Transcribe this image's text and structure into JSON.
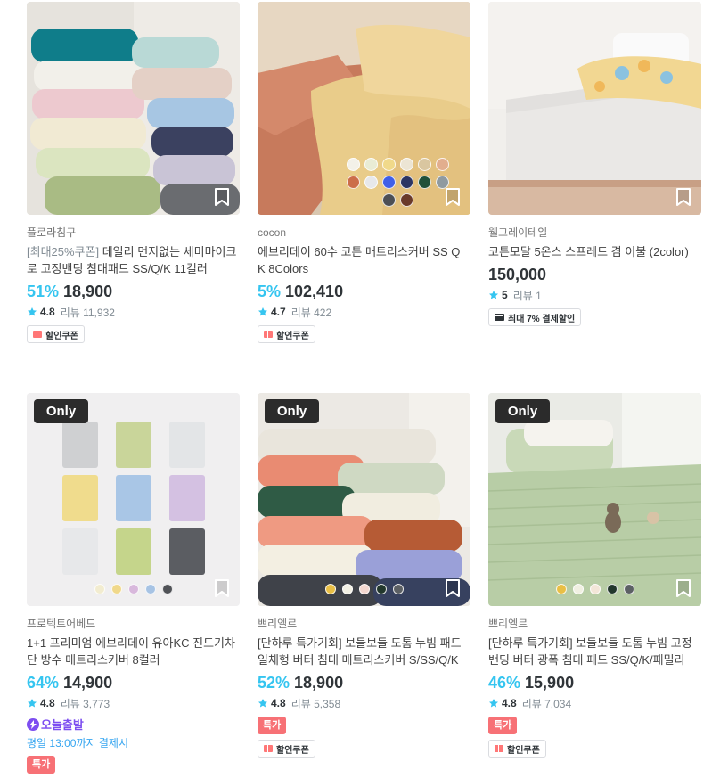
{
  "products": [
    {
      "brand": "플로라침구",
      "title_prefix": "[최대25%쿠폰]",
      "title": " 데일리 먼지없는 세미마이크로 고정밴딩 침대패드 SS/Q/K 11컬러",
      "discount": "51%",
      "price": "18,900",
      "rating": "4.8",
      "review": "리뷰 11,932",
      "tag_label": "할인쿠폰",
      "only": false
    },
    {
      "brand": "cocon",
      "title_prefix": "",
      "title": "에브리데이 60수 코튼 매트리스커버 SS Q K 8Colors",
      "discount": "5%",
      "price": "102,410",
      "rating": "4.7",
      "review": "리뷰 422",
      "tag_label": "할인쿠폰",
      "swatches": [
        "#f3f1e8",
        "#e9ecd5",
        "#f0d98a",
        "#ece5d4",
        "#d9c6a0",
        "#e2ae8e",
        "#cc6d4a",
        "#e7e8ea",
        "#3f5fe8",
        "#2c3563",
        "#20513a",
        "#8f9aa0",
        "#4d4f55",
        "#6a3a2a"
      ],
      "only": false
    },
    {
      "brand": "웰그레이테일",
      "title_prefix": "",
      "title": "코튼모달 5온스 스프레드 겸 이불 (2color)",
      "discount": "",
      "price": "150,000",
      "rating": "5",
      "review": "리뷰 1",
      "tag_label": "최대 7% 결제할인",
      "only": false
    },
    {
      "brand": "프로텍트어베드",
      "title_prefix": "",
      "title": "1+1 프리미엄 에브리데이 유아KC 진드기차단 방수 매트리스커버 8컬러",
      "discount": "64%",
      "price": "14,900",
      "rating": "4.8",
      "review": "리뷰 3,773",
      "only_label": "Only",
      "today_label": "오늘출발",
      "today_sub": "평일 13:00까지 결제시",
      "special_label": "특가",
      "swatches": [
        "#f2ecd0",
        "#f0d88a",
        "#d8b8dc",
        "#a7c3e4",
        "#505257"
      ],
      "only": true
    },
    {
      "brand": "쁘리엘르",
      "title_prefix": "",
      "title": "[단하루 특가기회] 보들보들 도톰 누빔 패드 일체형 버터 침대 매트리스커버 S/SS/Q/K",
      "discount": "52%",
      "price": "18,900",
      "rating": "4.8",
      "review": "리뷰 5,358",
      "only_label": "Only",
      "special_label": "특가",
      "tag_label": "할인쿠폰",
      "swatches": [
        "#e9bf45",
        "#f3f1e4",
        "#f3d7cf",
        "#22372c",
        "#5c6064"
      ],
      "only": true
    },
    {
      "brand": "쁘리엘르",
      "title_prefix": "",
      "title": "[단하루 특가기회] 보들보들 도톰 누빔 고정밴딩 버터 광폭 침대 패드 SS/Q/K/패밀리",
      "discount": "46%",
      "price": "15,900",
      "rating": "4.8",
      "review": "리뷰 7,034",
      "only_label": "Only",
      "special_label": "특가",
      "tag_label": "할인쿠폰",
      "swatches": [
        "#e9bf45",
        "#f1f0e2",
        "#f3e6d8",
        "#22372c",
        "#5c6064"
      ],
      "only": true
    }
  ],
  "colors": {
    "accent": "#35c5f0",
    "special": "#f77176",
    "today": "#7d4ef0",
    "text": "#2f3438",
    "muted": "#828c94"
  }
}
